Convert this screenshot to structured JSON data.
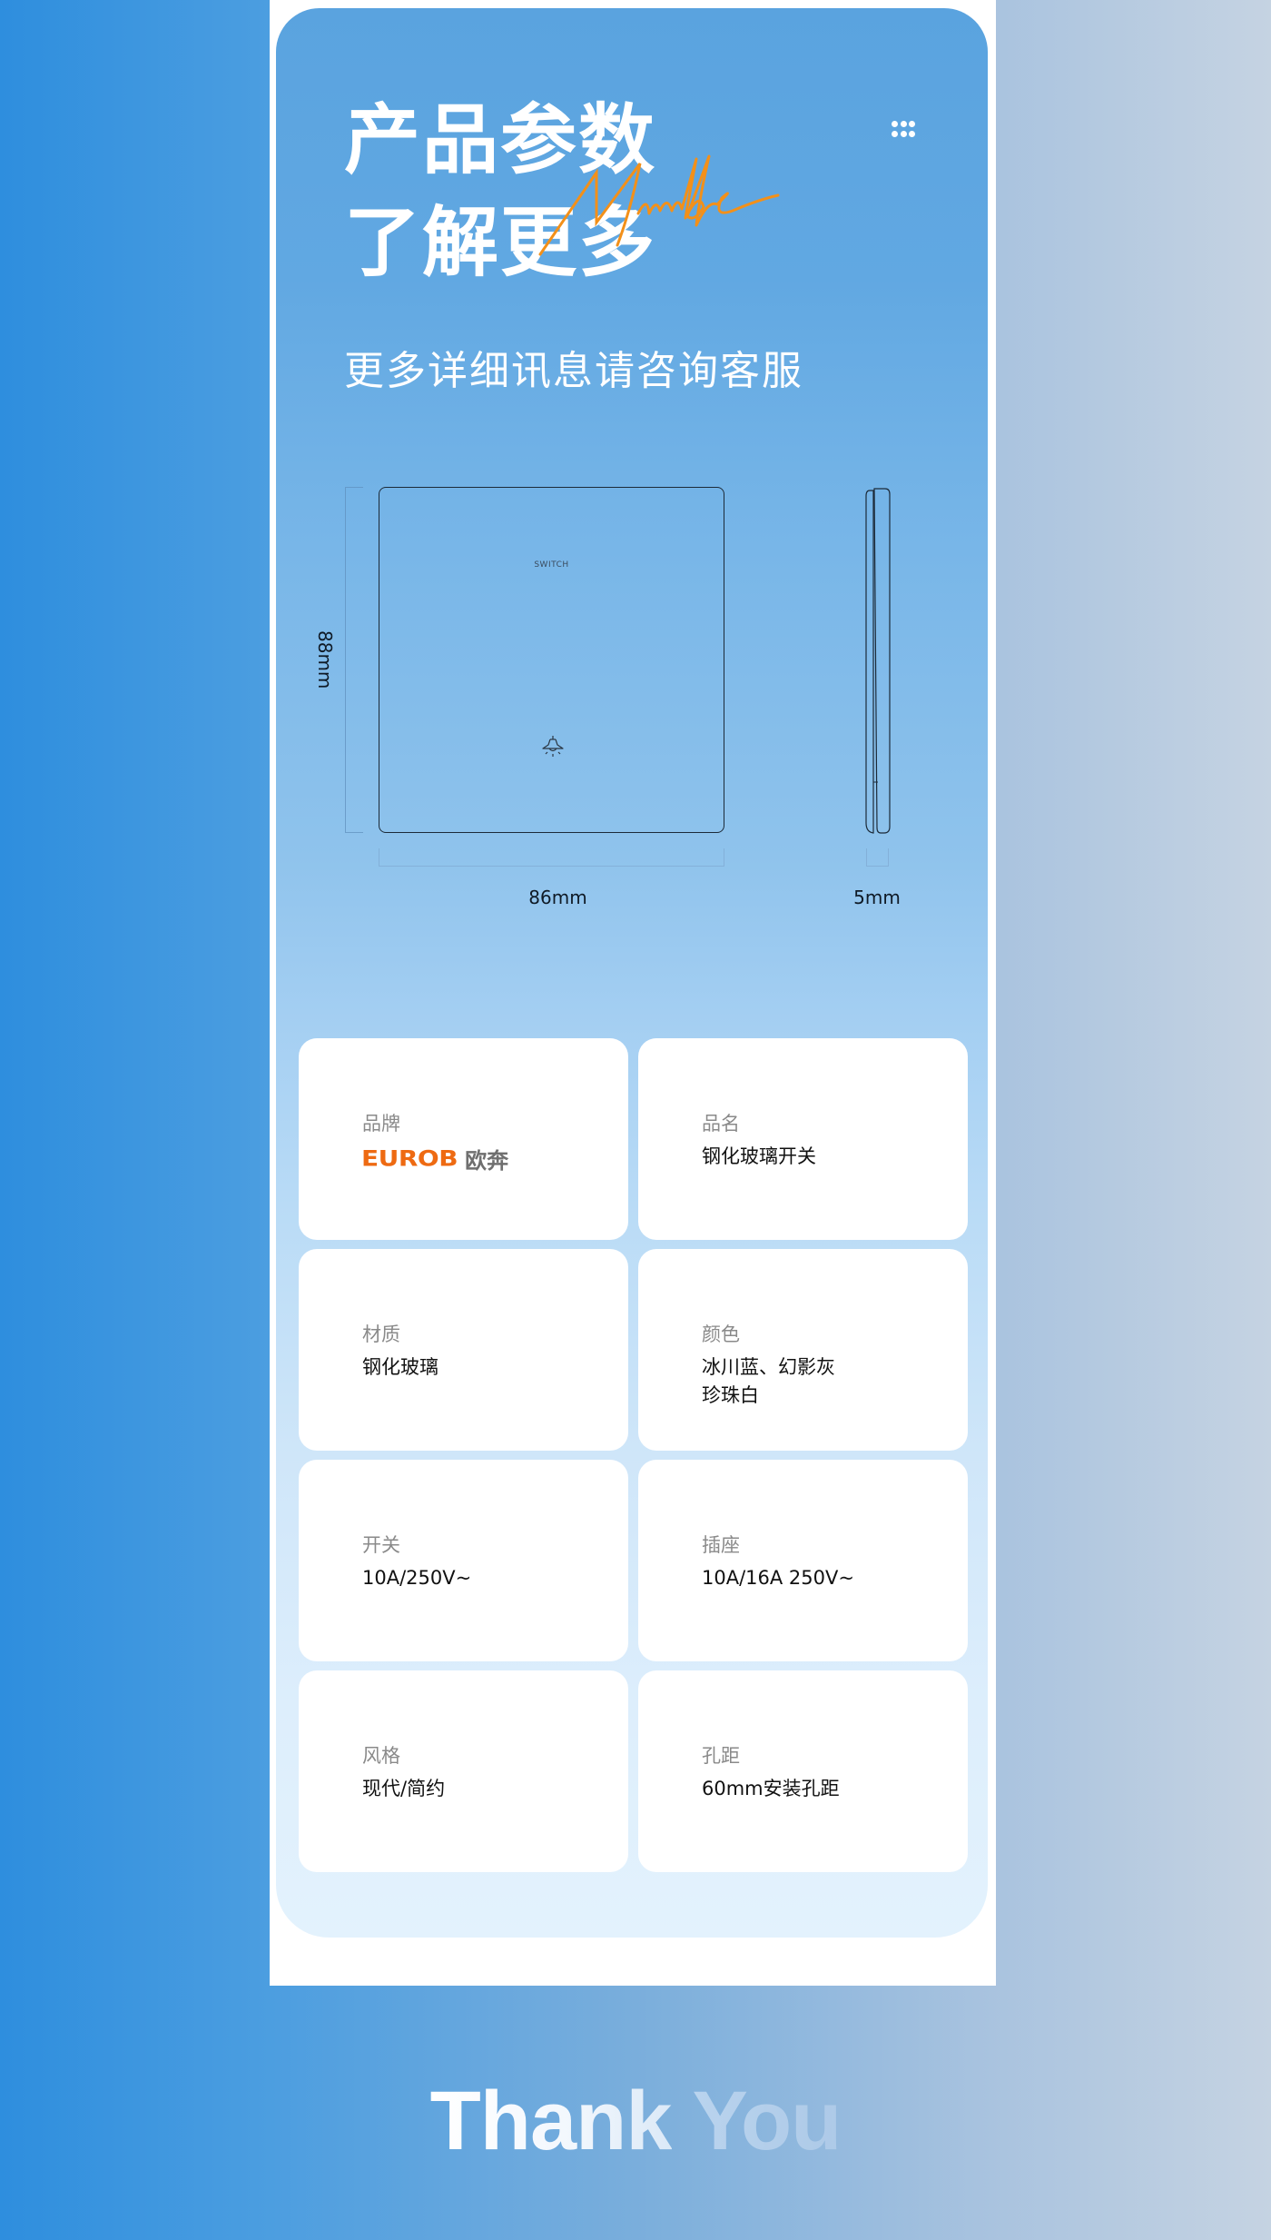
{
  "header": {
    "title_line1": "产品参数",
    "title_line2": "了解更多",
    "signature": "Nimble",
    "subtitle": "更多详细讯息请咨询客服",
    "menu_icon": "dots-grid-icon"
  },
  "diagram": {
    "switch_text": "SWITCH",
    "lamp_icon": "ceiling-lamp-icon",
    "width_label": "86mm",
    "height_label": "88mm",
    "depth_label": "5mm"
  },
  "specs": [
    {
      "label": "品牌",
      "brand_en": "EUROB",
      "brand_cn": "欧奔"
    },
    {
      "label": "品名",
      "value": "钢化玻璃开关"
    },
    {
      "label": "材质",
      "value": "钢化玻璃"
    },
    {
      "label": "颜色",
      "value": "冰川蓝、幻影灰\n珍珠白"
    },
    {
      "label": "开关",
      "value": "10A/250V~"
    },
    {
      "label": "插座",
      "value": "10A/16A 250V~"
    },
    {
      "label": "风格",
      "value": "现代/简约"
    },
    {
      "label": "孔距",
      "value": "60mm安装孔距"
    }
  ],
  "footer": {
    "thank": "Thank",
    "you": "You"
  },
  "colors": {
    "brand_orange": "#ee6a12",
    "signature_orange": "#f39019",
    "panel_top": "#5aa3df",
    "panel_bottom": "#e3f2fd"
  }
}
